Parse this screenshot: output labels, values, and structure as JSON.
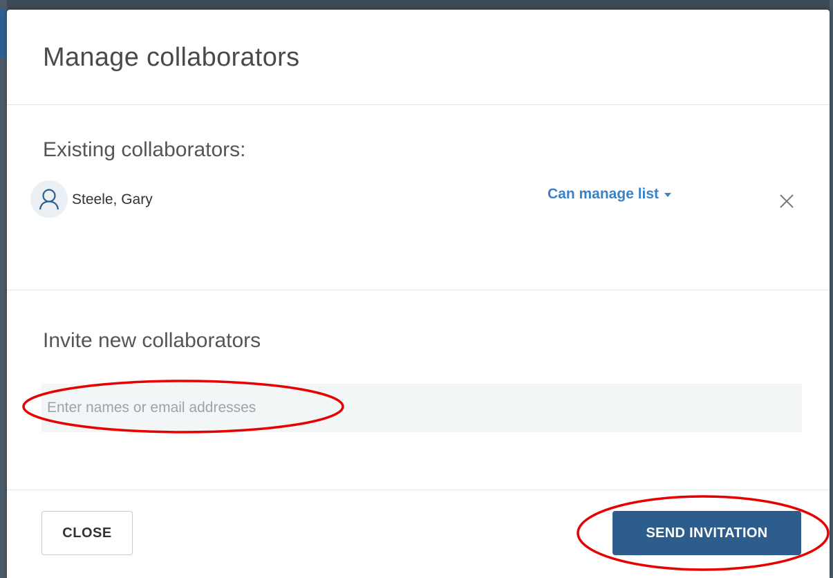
{
  "modal": {
    "title": "Manage collaborators"
  },
  "existing": {
    "heading": "Existing collaborators:",
    "collaborators": [
      {
        "name": "Steele, Gary",
        "avatar_icon": "user-outline-icon",
        "role": "Can manage list",
        "role_icon": "caret-down-icon",
        "remove_icon": "close-x-icon"
      }
    ]
  },
  "invite": {
    "heading": "Invite new collaborators",
    "input_value": "",
    "input_placeholder": "Enter names or email addresses"
  },
  "footer": {
    "close_label": "CLOSE",
    "send_label": "SEND INVITATION"
  },
  "colors": {
    "primary_button": "#2c5d8c",
    "link": "#3a82c4",
    "annotation": "#e60000",
    "input_background": "#f3f6f7"
  }
}
